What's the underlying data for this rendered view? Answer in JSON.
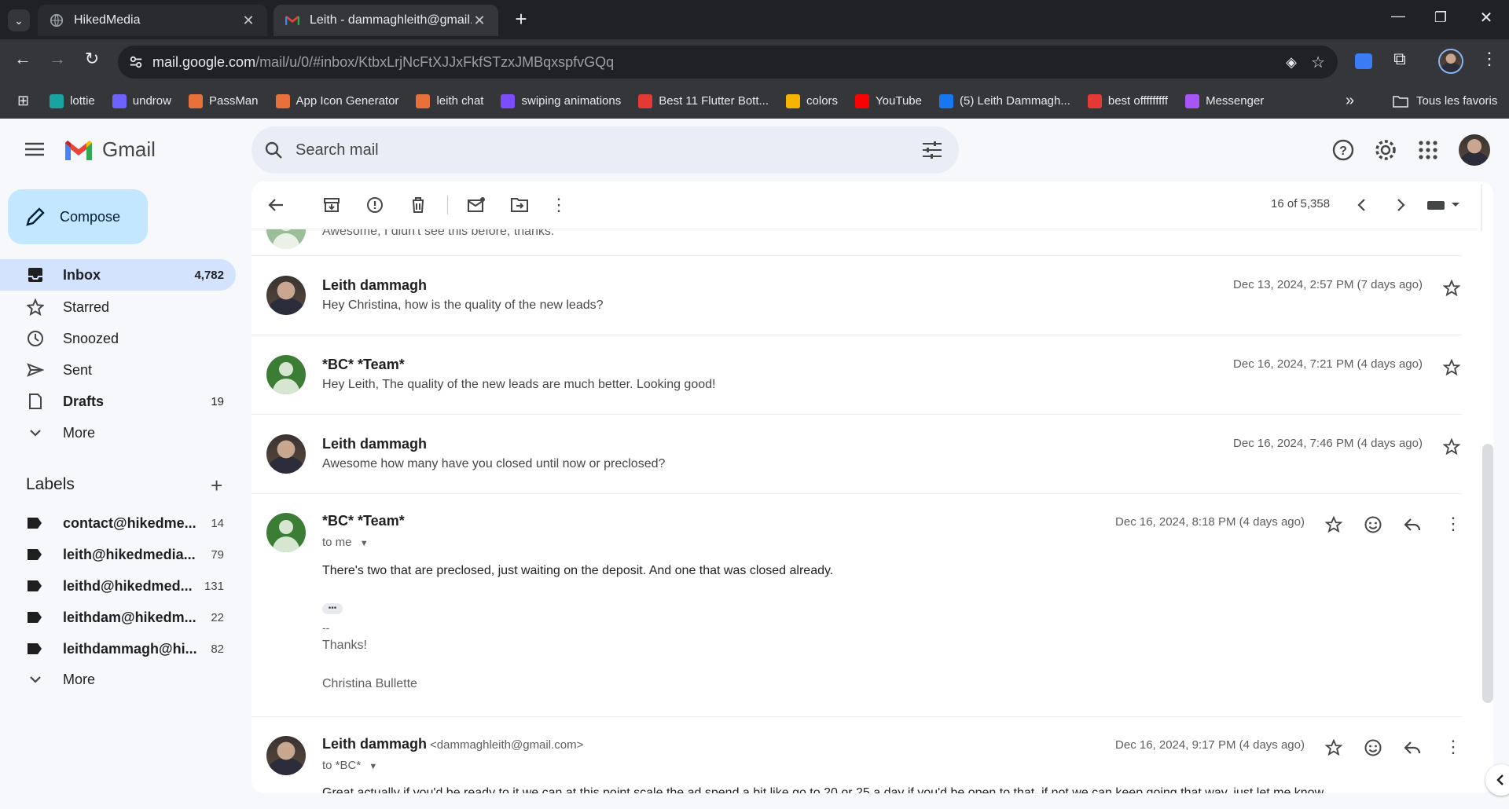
{
  "browser": {
    "tabs": [
      {
        "title": "HikedMedia",
        "close": "✕"
      },
      {
        "title": "Leith - dammaghleith@gmail.com",
        "close": "✕"
      }
    ],
    "new_tab": "+",
    "url_domain": "mail.google.com",
    "url_path": "/mail/u/0/#inbox/KtbxLrjNcFtXJJxFkfSTzxJMBqxspfvGQq",
    "bookmarks": [
      {
        "label": "lottie",
        "color": "#1aa3a3"
      },
      {
        "label": "undrow",
        "color": "#6c63ff"
      },
      {
        "label": "PassMan",
        "color": "#e8703a"
      },
      {
        "label": "App Icon Generator",
        "color": "#e8703a"
      },
      {
        "label": "leith chat",
        "color": "#e8703a"
      },
      {
        "label": "swiping animations",
        "color": "#7b4dff"
      },
      {
        "label": "Best 11 Flutter Bott...",
        "color": "#e53935"
      },
      {
        "label": "colors",
        "color": "#f4b400"
      },
      {
        "label": "YouTube",
        "color": "#ff0000"
      },
      {
        "label": "(5) Leith Dammagh...",
        "color": "#1877f2"
      },
      {
        "label": "best offfffffff",
        "color": "#e53935"
      },
      {
        "label": "Messenger",
        "color": "#a855f7"
      }
    ],
    "bookmarks_more": "»",
    "all_favorites": "Tous les favoris"
  },
  "gmail": {
    "logo_text": "Gmail",
    "search_placeholder": "Search mail",
    "compose": "Compose",
    "nav": [
      {
        "label": "Inbox",
        "count": "4,782",
        "icon": "inbox-icon"
      },
      {
        "label": "Starred",
        "count": "",
        "icon": "star-icon"
      },
      {
        "label": "Snoozed",
        "count": "",
        "icon": "clock-icon"
      },
      {
        "label": "Sent",
        "count": "",
        "icon": "send-icon"
      },
      {
        "label": "Drafts",
        "count": "19",
        "icon": "draft-icon"
      },
      {
        "label": "More",
        "count": "",
        "icon": "chevron-down-icon"
      }
    ],
    "labels_heading": "Labels",
    "labels": [
      {
        "label": "contact@hikedme...",
        "count": "14"
      },
      {
        "label": "leith@hikedmedia...",
        "count": "79"
      },
      {
        "label": "leithd@hikedmed...",
        "count": "131"
      },
      {
        "label": "leithdam@hikedm...",
        "count": "22"
      },
      {
        "label": "leithdammagh@hi...",
        "count": "82"
      }
    ],
    "labels_more": "More",
    "pagination": "16 of 5,358"
  },
  "thread": {
    "top_partial": "Awesome, I didn't see this before, thanks.",
    "messages": [
      {
        "sender": "Leith dammagh",
        "snippet": "Hey Christina, how is the quality of the new leads?",
        "date": "Dec 13, 2024, 2:57 PM (7 days ago)"
      },
      {
        "sender": "*BC* *Team*",
        "snippet": "Hey Leith, The quality of the new leads are much better. Looking good!",
        "date": "Dec 16, 2024, 7:21 PM (4 days ago)"
      },
      {
        "sender": "Leith dammagh",
        "snippet": "Awesome how many have you closed until now or preclosed?",
        "date": "Dec 16, 2024, 7:46 PM (4 days ago)"
      }
    ],
    "expanded": {
      "sender": "*BC* *Team*",
      "to": "to me",
      "date": "Dec 16, 2024, 8:18 PM (4 days ago)",
      "body": "There's two that are preclosed, just waiting on the deposit. And one that was closed already.",
      "dots": "•••",
      "sig_dash": "--",
      "thanks": "Thanks!",
      "signature": "Christina Bullette"
    },
    "last": {
      "sender": "Leith dammagh",
      "email": "<dammaghleith@gmail.com>",
      "to": "to *BC*",
      "date": "Dec 16, 2024, 9:17 PM (4 days ago)",
      "body": "Great actually if you'd be ready to it we can at this point scale the ad spend a bit like go to 20 or 25 a day if you'd be open to that, if not we can keep going that way, just let me know"
    }
  }
}
